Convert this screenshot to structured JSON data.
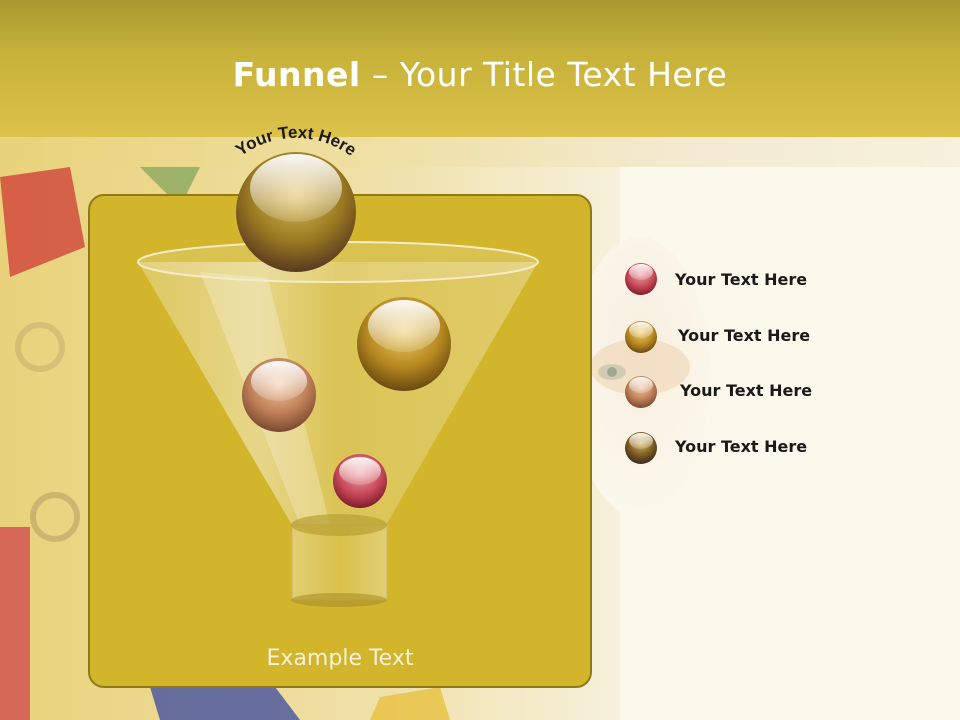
{
  "slide": {
    "title_bold": "Funnel",
    "title_rest": " – Your Title Text Here",
    "arc_text": "Your Text Here",
    "example_text": "Example Text"
  },
  "legend": [
    {
      "label": "Your  Text Here",
      "color": "#c0505a"
    },
    {
      "label": "Your  Text Here",
      "color": "#c8961e"
    },
    {
      "label": "Your  Text Here",
      "color": "#c88660"
    },
    {
      "label": "Your  Text Here",
      "color": "#5a3a3a"
    }
  ],
  "colors": {
    "header": "#c8b23a",
    "panel": "#d2b52a",
    "panel_border": "#8f7a18"
  }
}
